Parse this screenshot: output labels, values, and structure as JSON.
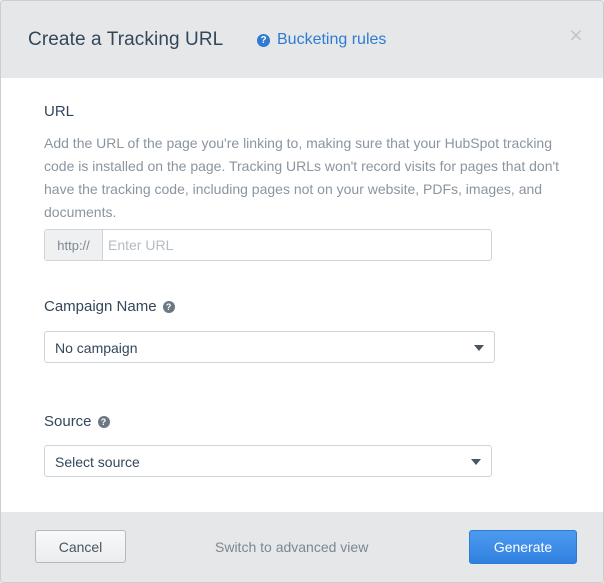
{
  "dialog": {
    "title": "Create a Tracking URL",
    "help_link": "Bucketing rules",
    "close_symbol": "×"
  },
  "url_section": {
    "label": "URL",
    "description": "Add the URL of the page you're linking to, making sure that your HubSpot tracking code is installed on the page. Tracking URLs won't record visits for pages that don't have the tracking code, including pages not on your website, PDFs, images, and documents.",
    "prefix": "http://",
    "placeholder": "Enter URL",
    "value": ""
  },
  "campaign": {
    "label": "Campaign Name",
    "selected": "No campaign"
  },
  "source": {
    "label": "Source",
    "selected": "Select source"
  },
  "footer": {
    "cancel_label": "Cancel",
    "switch_label": "Switch to advanced view",
    "generate_label": "Generate"
  },
  "icons": {
    "help": "question-circle-icon",
    "close": "close-icon",
    "dropdown": "chevron-down-icon"
  },
  "colors": {
    "accent": "#2f7bd4",
    "header_bg": "#e6e7e8",
    "text": "#33475b"
  }
}
